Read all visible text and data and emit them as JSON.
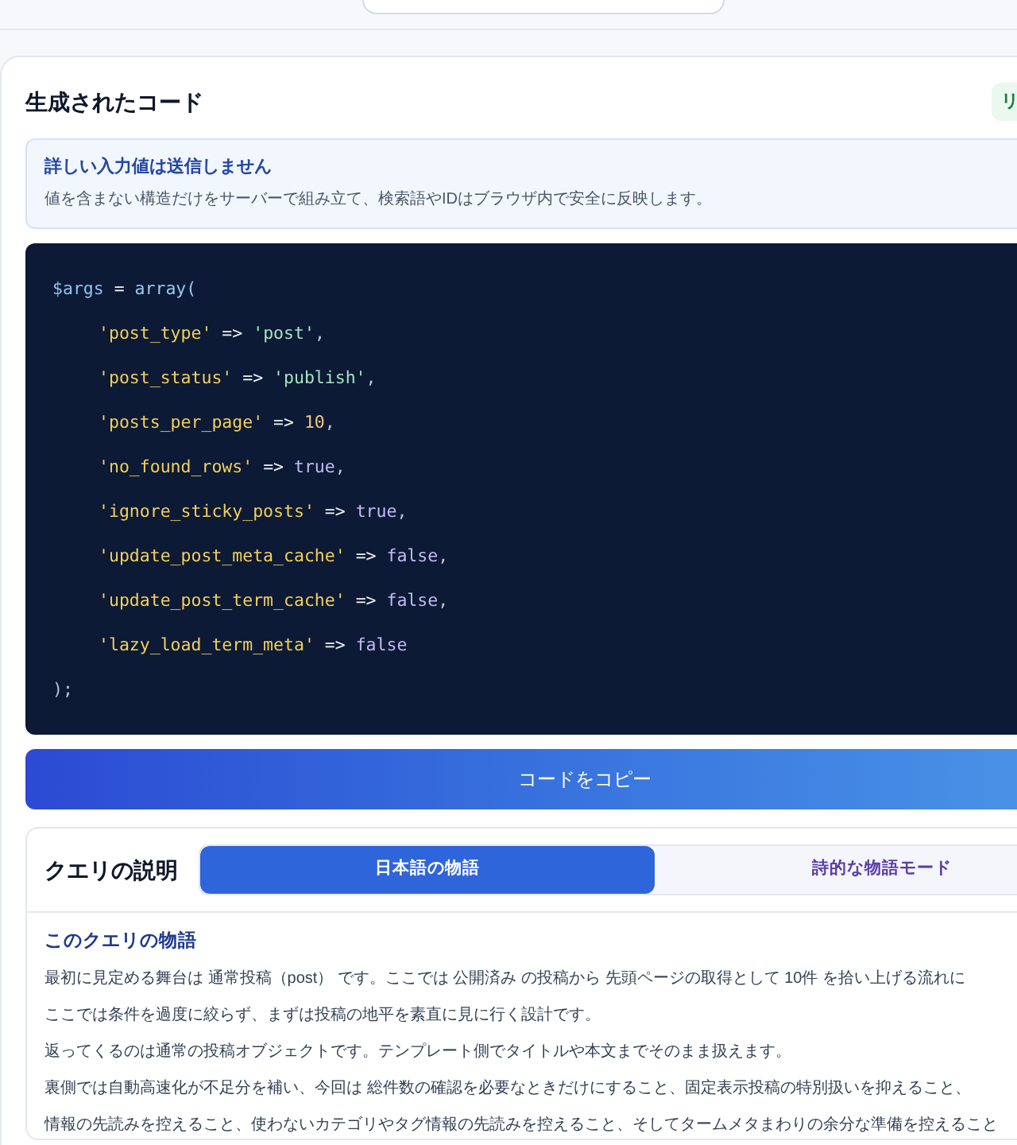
{
  "code_panel": {
    "title": "生成されたコード",
    "badge": "リ",
    "notice": {
      "title": "詳しい入力値は送信しません",
      "text": "値を含まない構造だけをサーバーで組み立て、検索語やIDはブラウザ内で安全に反映します。"
    },
    "code": {
      "lines": [
        {
          "tokens": [
            {
              "text": "$args",
              "kind": "variable"
            },
            {
              "text": " = ",
              "kind": "operator"
            },
            {
              "text": "array(",
              "kind": "function"
            }
          ],
          "children": [
            {
              "tokens": [
                {
                  "text": "'post_type'",
                  "kind": "key"
                },
                {
                  "text": " => ",
                  "kind": "operator"
                },
                {
                  "text": "'post'",
                  "kind": "string"
                },
                {
                  "text": ",",
                  "kind": "punctuation"
                }
              ]
            },
            {
              "tokens": [
                {
                  "text": "'post_status'",
                  "kind": "key"
                },
                {
                  "text": " => ",
                  "kind": "operator"
                },
                {
                  "text": "'publish'",
                  "kind": "string"
                },
                {
                  "text": ",",
                  "kind": "punctuation"
                }
              ]
            },
            {
              "tokens": [
                {
                  "text": "'posts_per_page'",
                  "kind": "key"
                },
                {
                  "text": " => ",
                  "kind": "operator"
                },
                {
                  "text": "10",
                  "kind": "number"
                },
                {
                  "text": ",",
                  "kind": "punctuation"
                }
              ]
            },
            {
              "tokens": [
                {
                  "text": "'no_found_rows'",
                  "kind": "key"
                },
                {
                  "text": " => ",
                  "kind": "operator"
                },
                {
                  "text": "true",
                  "kind": "boolean"
                },
                {
                  "text": ",",
                  "kind": "punctuation"
                }
              ]
            },
            {
              "tokens": [
                {
                  "text": "'ignore_sticky_posts'",
                  "kind": "key"
                },
                {
                  "text": " => ",
                  "kind": "operator"
                },
                {
                  "text": "true",
                  "kind": "boolean"
                },
                {
                  "text": ",",
                  "kind": "punctuation"
                }
              ]
            },
            {
              "tokens": [
                {
                  "text": "'update_post_meta_cache'",
                  "kind": "key"
                },
                {
                  "text": " => ",
                  "kind": "operator"
                },
                {
                  "text": "false",
                  "kind": "boolean"
                },
                {
                  "text": ",",
                  "kind": "punctuation"
                }
              ]
            },
            {
              "tokens": [
                {
                  "text": "'update_post_term_cache'",
                  "kind": "key"
                },
                {
                  "text": " => ",
                  "kind": "operator"
                },
                {
                  "text": "false",
                  "kind": "boolean"
                },
                {
                  "text": ",",
                  "kind": "punctuation"
                }
              ]
            },
            {
              "tokens": [
                {
                  "text": "'lazy_load_term_meta'",
                  "kind": "key"
                },
                {
                  "text": " => ",
                  "kind": "operator"
                },
                {
                  "text": "false",
                  "kind": "boolean"
                }
              ]
            }
          ]
        },
        {
          "tokens": [
            {
              "text": ");",
              "kind": "punctuation"
            }
          ]
        }
      ]
    },
    "copy_button": "コードをコピー"
  },
  "explanation": {
    "title": "クエリの説明",
    "tabs": [
      {
        "label": "日本語の物語",
        "selected": true
      },
      {
        "label": "詩的な物語モード",
        "selected": false
      }
    ],
    "heading": "このクエリの物語",
    "paragraphs": [
      {
        "lines": [
          "最初に見定める舞台は 通常投稿（post） です。ここでは 公開済み の投稿から 先頭ページの取得として 10件 を拾い上げる流れに"
        ]
      },
      {
        "lines": [
          "ここでは条件を過度に絞らず、まずは投稿の地平を素直に見に行く設計です。"
        ]
      },
      {
        "lines": [
          "返ってくるのは通常の投稿オブジェクトです。テンプレート側でタイトルや本文までそのまま扱えます。"
        ]
      },
      {
        "lines": [
          "裏側では自動高速化が不足分を補い、今回は 総件数の確認を必要なときだけにすること、固定表示投稿の特別扱いを抑えること、",
          "情報の先読みを控えること、使わないカテゴリやタグ情報の先読みを控えること、そしてタームメタまわりの余分な準備を控えること"
        ]
      }
    ]
  }
}
